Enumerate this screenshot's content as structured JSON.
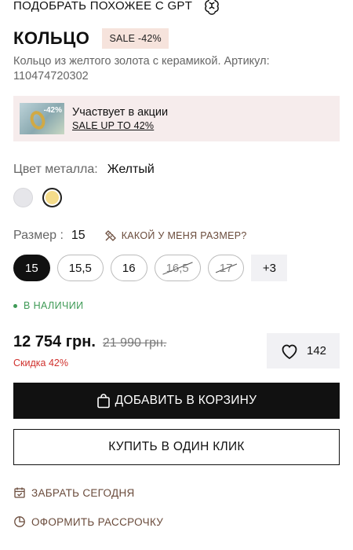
{
  "gpt": {
    "label": "ПОДОБРАТЬ ПОХОЖЕЕ С GPT",
    "icon": "openai-icon"
  },
  "product": {
    "title": "КОЛЬЦО",
    "sale_badge": "SALE -42%",
    "description": "Кольцо из желтого золота с керамикой. Артикул: 110474720302"
  },
  "promo": {
    "image_label": "-42%",
    "title": "Участвует в акции",
    "link": "SALE UP TO 42%"
  },
  "metal": {
    "label": "Цвет металла:",
    "value": "Желтый",
    "swatches": [
      {
        "name": "white",
        "color": "#e6e6ea",
        "selected": false
      },
      {
        "name": "yellow",
        "color": "#f5dc8a",
        "selected": true
      }
    ]
  },
  "size": {
    "label": "Размер :",
    "value": "15",
    "help": "КАКОЙ У МЕНЯ РАЗМЕР?",
    "options": [
      {
        "label": "15",
        "state": "selected"
      },
      {
        "label": "15,5",
        "state": "available"
      },
      {
        "label": "16",
        "state": "available"
      },
      {
        "label": "16,5",
        "state": "unavailable"
      },
      {
        "label": "17",
        "state": "unavailable"
      }
    ],
    "more": "+3"
  },
  "stock": {
    "label": "В НАЛИЧИИ",
    "color": "#3f9a56"
  },
  "price": {
    "current": "12 754 грн.",
    "old": "21 990 грн.",
    "discount": "Скидка 42%",
    "discount_color": "#d0312d"
  },
  "favorites": {
    "count": "142",
    "icon": "heart-icon"
  },
  "actions": {
    "add_to_cart": "ДОБАВИТЬ В КОРЗИНУ",
    "buy_one_click": "КУПИТЬ В ОДИН КЛИК",
    "pickup_today": "ЗАБРАТЬ СЕГОДНЯ",
    "installment": "ОФОРМИТЬ РАССРОЧКУ"
  },
  "colors": {
    "accent_brown": "#6a4b3b",
    "primary": "#111111",
    "promo_bg": "#f6ecec"
  }
}
